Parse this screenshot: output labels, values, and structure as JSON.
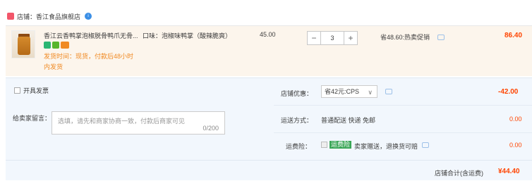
{
  "shop": {
    "label": "店铺：香江食品旗舰店",
    "badge": "i"
  },
  "item": {
    "title": "香江云香鸭掌泡椒脱骨鸭爪无骨...",
    "flavor": "口味：泡椒味鸭掌（酸辣脆爽）",
    "ship_time": "发货时间：现货，付款后48小时",
    "ship_time2": "内发货",
    "unit_price": "45.00",
    "quantity": "3",
    "minus": "−",
    "plus": "+",
    "promo": "省48.60:热卖促销",
    "subtotal": "86.40"
  },
  "options": {
    "invoice_label": "开具发票",
    "message_label": "给卖家留言：",
    "message_placeholder": "选填，请先和商家协商一致，付款后商家可见",
    "message_count": "0/200",
    "coupon_label": "店铺优惠：",
    "coupon_value": "省42元:CPS",
    "discount": "-42.00",
    "shipping_label": "运送方式：",
    "shipping_value": "普通配送 快递 免邮",
    "shipping_fee": "0.00",
    "insurance_label": "运费险：",
    "insurance_tag": "运费险",
    "insurance_text": "卖家赠送，退换货可赔",
    "insurance_fee": "0.00",
    "total_label": "店铺合计(含运费)",
    "total_value": "¥44.40"
  },
  "colors": {
    "price_red": "#ff4400",
    "accent_blue": "#3b8fe6",
    "item_bg": "#fcf5ec",
    "options_bg": "#f2f7fd"
  }
}
